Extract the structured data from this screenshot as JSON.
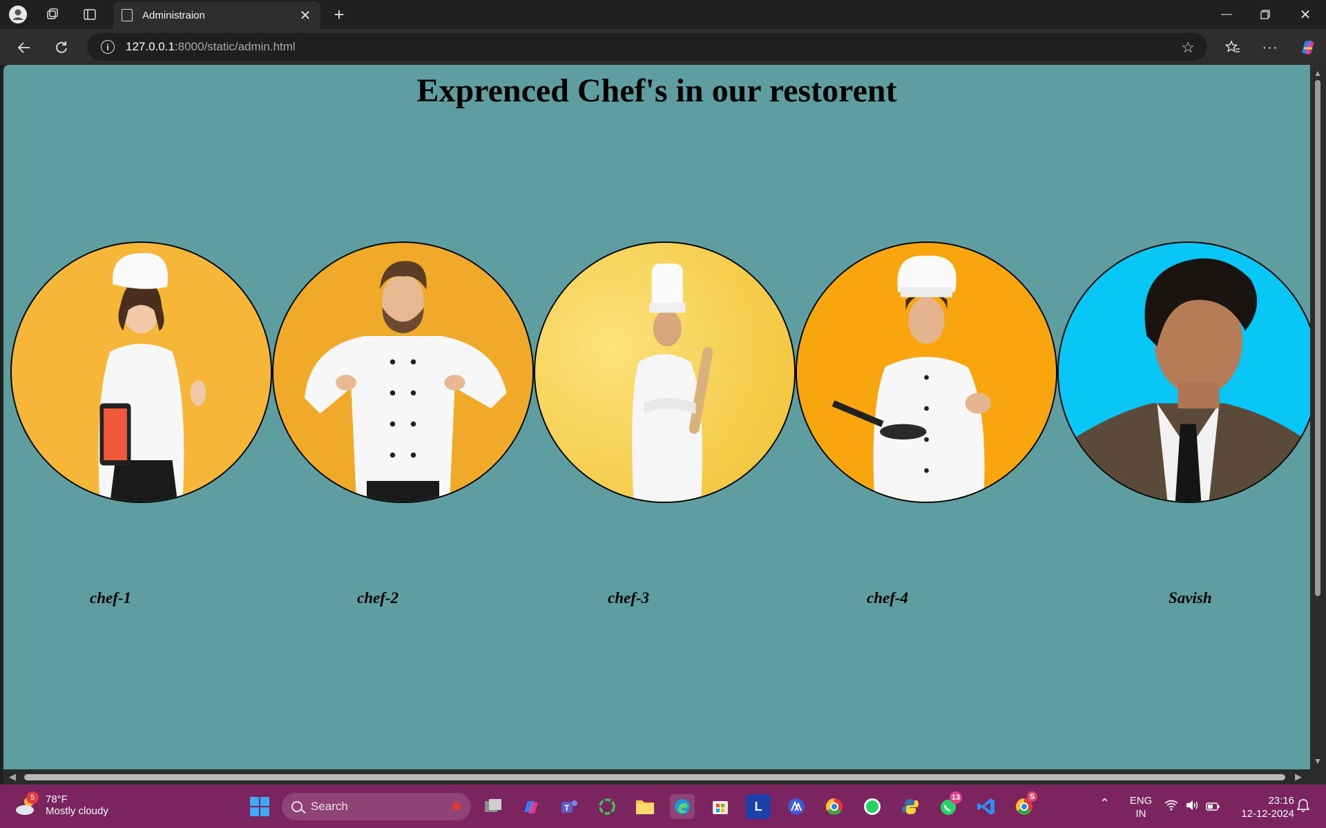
{
  "browser": {
    "tab_title": "Administraion",
    "url_host": "127.0.0.1",
    "url_path": ":8000/static/admin.html"
  },
  "page": {
    "title": "Exprenced Chef's in our restorent",
    "chefs": [
      {
        "name": "chef-1"
      },
      {
        "name": "chef-2"
      },
      {
        "name": "chef-3"
      },
      {
        "name": "chef-4"
      },
      {
        "name": "Savish"
      }
    ]
  },
  "taskbar": {
    "weather_temp": "78°F",
    "weather_desc": "Mostly cloudy",
    "weather_badge": "5",
    "search_placeholder": "Search",
    "whatsapp_badge": "13",
    "chrome_badge": "S",
    "lang_top": "ENG",
    "lang_bottom": "IN",
    "time": "23:16",
    "date": "12-12-2024"
  },
  "colors": {
    "page_background": "#5f9ea0",
    "taskbar": "#7c2460"
  }
}
